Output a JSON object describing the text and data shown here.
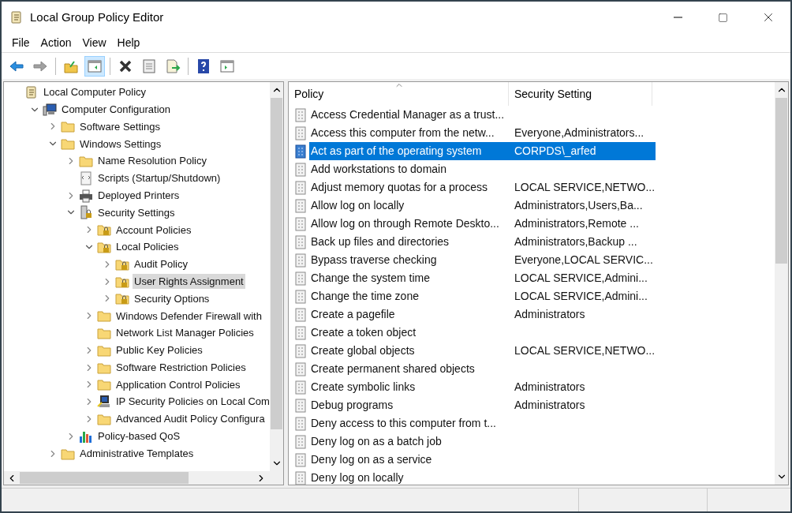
{
  "window": {
    "title": "Local Group Policy Editor"
  },
  "menu": [
    "File",
    "Action",
    "View",
    "Help"
  ],
  "toolbar": [
    {
      "kind": "back",
      "disabled": false,
      "selected": false
    },
    {
      "kind": "forward",
      "disabled": true,
      "selected": false
    },
    {
      "kind": "separator"
    },
    {
      "kind": "up",
      "disabled": false,
      "selected": false
    },
    {
      "kind": "tree-toggle",
      "disabled": false,
      "selected": true
    },
    {
      "kind": "separator"
    },
    {
      "kind": "delete",
      "disabled": false,
      "selected": false
    },
    {
      "kind": "properties",
      "disabled": false,
      "selected": false
    },
    {
      "kind": "export",
      "disabled": false,
      "selected": false
    },
    {
      "kind": "separator"
    },
    {
      "kind": "help",
      "disabled": false,
      "selected": false
    },
    {
      "kind": "action-pane",
      "disabled": false,
      "selected": false
    }
  ],
  "tree": [
    {
      "label": "Local Computer Policy",
      "kind": "scroll",
      "selected": false,
      "children": [
        {
          "label": "Computer Configuration",
          "kind": "computer",
          "expandable": true,
          "expanded": true,
          "selected": false,
          "children": [
            {
              "label": "Software Settings",
              "kind": "folder",
              "expandable": true,
              "expanded": false,
              "selected": false
            },
            {
              "label": "Windows Settings",
              "kind": "folder",
              "expandable": true,
              "expanded": true,
              "selected": false,
              "children": [
                {
                  "label": "Name Resolution Policy",
                  "kind": "folder",
                  "expandable": true,
                  "expanded": false,
                  "selected": false
                },
                {
                  "label": "Scripts (Startup/Shutdown)",
                  "kind": "script",
                  "expandable": false,
                  "selected": false
                },
                {
                  "label": "Deployed Printers",
                  "kind": "printer",
                  "expandable": true,
                  "expanded": false,
                  "selected": false
                },
                {
                  "label": "Security Settings",
                  "kind": "security",
                  "expandable": true,
                  "expanded": true,
                  "selected": false,
                  "children": [
                    {
                      "label": "Account Policies",
                      "kind": "lock-folder",
                      "expandable": true,
                      "expanded": false,
                      "selected": false
                    },
                    {
                      "label": "Local Policies",
                      "kind": "lock-folder",
                      "expandable": true,
                      "expanded": true,
                      "selected": false,
                      "children": [
                        {
                          "label": "Audit Policy",
                          "kind": "lock-folder",
                          "expandable": true,
                          "expanded": false,
                          "selected": false
                        },
                        {
                          "label": "User Rights Assignment",
                          "kind": "lock-folder",
                          "expandable": true,
                          "expanded": false,
                          "selected": true
                        },
                        {
                          "label": "Security Options",
                          "kind": "lock-folder",
                          "expandable": true,
                          "expanded": false,
                          "selected": false
                        }
                      ]
                    },
                    {
                      "label": "Windows Defender Firewall with",
                      "kind": "folder",
                      "expandable": true,
                      "expanded": false,
                      "selected": false
                    },
                    {
                      "label": "Network List Manager Policies",
                      "kind": "folder",
                      "expandable": false,
                      "selected": false
                    },
                    {
                      "label": "Public Key Policies",
                      "kind": "folder",
                      "expandable": true,
                      "expanded": false,
                      "selected": false
                    },
                    {
                      "label": "Software Restriction Policies",
                      "kind": "folder",
                      "expandable": true,
                      "expanded": false,
                      "selected": false
                    },
                    {
                      "label": "Application Control Policies",
                      "kind": "folder",
                      "expandable": true,
                      "expanded": false,
                      "selected": false
                    },
                    {
                      "label": "IP Security Policies on Local Com",
                      "kind": "ip-security",
                      "expandable": true,
                      "expanded": false,
                      "selected": false
                    },
                    {
                      "label": "Advanced Audit Policy Configura",
                      "kind": "folder",
                      "expandable": true,
                      "expanded": false,
                      "selected": false
                    }
                  ]
                },
                {
                  "label": "Policy-based QoS",
                  "kind": "qos",
                  "expandable": true,
                  "expanded": false,
                  "selected": false
                }
              ]
            },
            {
              "label": "Administrative Templates",
              "kind": "folder",
              "expandable": true,
              "expanded": false,
              "selected": false
            }
          ]
        }
      ]
    }
  ],
  "table": {
    "columns": [
      {
        "label": "Policy",
        "sorted": true
      },
      {
        "label": "Security Setting",
        "sorted": false
      }
    ],
    "rows": [
      {
        "policy": "Access Credential Manager as a trust...",
        "setting": "",
        "selected": false
      },
      {
        "policy": "Access this computer from the netw...",
        "setting": "Everyone,Administrators...",
        "selected": false
      },
      {
        "policy": "Act as part of the operating system",
        "setting": "CORPDS\\_arfed",
        "selected": true
      },
      {
        "policy": "Add workstations to domain",
        "setting": "",
        "selected": false
      },
      {
        "policy": "Adjust memory quotas for a process",
        "setting": "LOCAL SERVICE,NETWO...",
        "selected": false
      },
      {
        "policy": "Allow log on locally",
        "setting": "Administrators,Users,Ba...",
        "selected": false
      },
      {
        "policy": "Allow log on through Remote Deskto...",
        "setting": "Administrators,Remote ...",
        "selected": false
      },
      {
        "policy": "Back up files and directories",
        "setting": "Administrators,Backup ...",
        "selected": false
      },
      {
        "policy": "Bypass traverse checking",
        "setting": "Everyone,LOCAL SERVIC...",
        "selected": false
      },
      {
        "policy": "Change the system time",
        "setting": "LOCAL SERVICE,Admini...",
        "selected": false
      },
      {
        "policy": "Change the time zone",
        "setting": "LOCAL SERVICE,Admini...",
        "selected": false
      },
      {
        "policy": "Create a pagefile",
        "setting": "Administrators",
        "selected": false
      },
      {
        "policy": "Create a token object",
        "setting": "",
        "selected": false
      },
      {
        "policy": "Create global objects",
        "setting": "LOCAL SERVICE,NETWO...",
        "selected": false
      },
      {
        "policy": "Create permanent shared objects",
        "setting": "",
        "selected": false
      },
      {
        "policy": "Create symbolic links",
        "setting": "Administrators",
        "selected": false
      },
      {
        "policy": "Debug programs",
        "setting": "Administrators",
        "selected": false
      },
      {
        "policy": "Deny access to this computer from t...",
        "setting": "",
        "selected": false
      },
      {
        "policy": "Deny log on as a batch job",
        "setting": "",
        "selected": false
      },
      {
        "policy": "Deny log on as a service",
        "setting": "",
        "selected": false
      },
      {
        "policy": "Deny log on locally",
        "setting": "",
        "selected": false
      }
    ]
  }
}
